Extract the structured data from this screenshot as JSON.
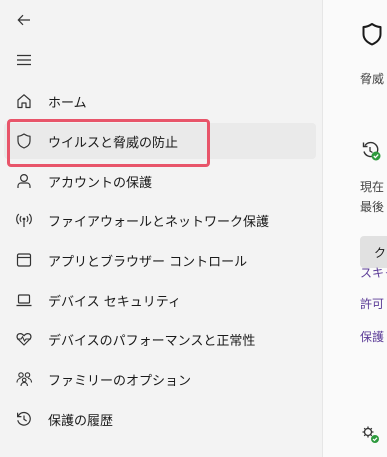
{
  "sidebar": {
    "items": [
      {
        "label": "ホーム",
        "icon": "home-icon"
      },
      {
        "label": "ウイルスと脅威の防止",
        "icon": "shield-icon",
        "selected": true
      },
      {
        "label": "アカウントの保護",
        "icon": "person-icon"
      },
      {
        "label": "ファイアウォールとネットワーク保護",
        "icon": "wireless-antenna-icon"
      },
      {
        "label": "アプリとブラウザー コントロール",
        "icon": "app-window-icon"
      },
      {
        "label": "デバイス セキュリティ",
        "icon": "laptop-icon"
      },
      {
        "label": "デバイスのパフォーマンスと正常性",
        "icon": "heart-pulse-icon"
      },
      {
        "label": "ファミリーのオプション",
        "icon": "family-icon"
      },
      {
        "label": "保護の履歴",
        "icon": "history-icon"
      }
    ]
  },
  "content": {
    "subtitle_fragment": "脅威",
    "status_line1": "現在",
    "status_line2": "最後",
    "button_fragment": "ク",
    "link1": "スキャ",
    "link2": "許可",
    "link3": "保護"
  },
  "colors": {
    "highlight": "#e8556a",
    "link": "#5b3b97",
    "check": "#2e9a3e"
  }
}
